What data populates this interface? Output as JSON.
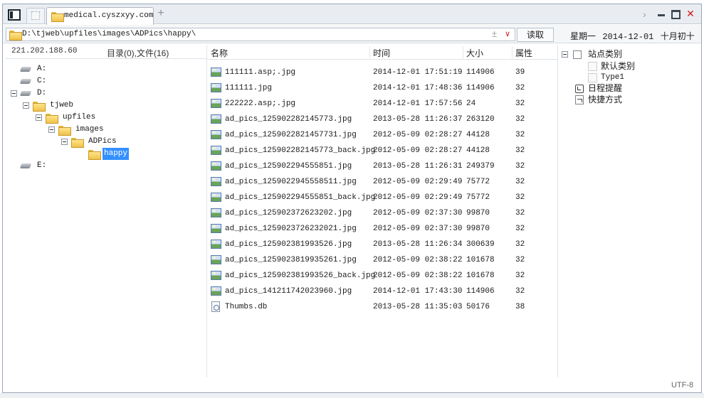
{
  "tabs": [
    {
      "label": "medical.cyszxyy.com"
    }
  ],
  "address": {
    "path": "D:\\tjweb\\upfiles\\images\\ADPics\\happy\\",
    "plus": "±",
    "dropdown": "∨",
    "read_label": "读取"
  },
  "header_date": {
    "weekday": "星期一",
    "date": "2014-12-01",
    "lunar": "十月初十"
  },
  "left": {
    "host": "221.202.188.60",
    "summary": "目录(0),文件(16)",
    "tree": [
      {
        "label": "A:"
      },
      {
        "label": "C:"
      },
      {
        "label": "D:"
      },
      {
        "label": "tjweb"
      },
      {
        "label": "upfiles"
      },
      {
        "label": "images"
      },
      {
        "label": "ADPics"
      },
      {
        "label": "happy"
      },
      {
        "label": "E:"
      }
    ]
  },
  "list": {
    "columns": {
      "name": "名称",
      "time": "时间",
      "size": "大小",
      "attr": "属性"
    },
    "rows": [
      {
        "name": "111111.asp;.jpg",
        "time": "2014-12-01 17:51:19",
        "size": "114906",
        "attr": "39"
      },
      {
        "name": "111111.jpg",
        "time": "2014-12-01 17:48:36",
        "size": "114906",
        "attr": "32"
      },
      {
        "name": "222222.asp;.jpg",
        "time": "2014-12-01 17:57:56",
        "size": "24",
        "attr": "32"
      },
      {
        "name": "ad_pics_125902282145773.jpg",
        "time": "2013-05-28 11:26:37",
        "size": "263120",
        "attr": "32"
      },
      {
        "name": "ad_pics_1259022821457731.jpg",
        "time": "2012-05-09 02:28:27",
        "size": "44128",
        "attr": "32"
      },
      {
        "name": "ad_pics_125902282145773_back.jpg",
        "time": "2012-05-09 02:28:27",
        "size": "44128",
        "attr": "32"
      },
      {
        "name": "ad_pics_125902294555851.jpg",
        "time": "2013-05-28 11:26:31",
        "size": "249379",
        "attr": "32"
      },
      {
        "name": "ad_pics_1259022945558511.jpg",
        "time": "2012-05-09 02:29:49",
        "size": "75772",
        "attr": "32"
      },
      {
        "name": "ad_pics_125902294555851_back.jpg",
        "time": "2012-05-09 02:29:49",
        "size": "75772",
        "attr": "32"
      },
      {
        "name": "ad_pics_125902372623202.jpg",
        "time": "2012-05-09 02:37:30",
        "size": "99870",
        "attr": "32"
      },
      {
        "name": "ad_pics_1259023726232021.jpg",
        "time": "2012-05-09 02:37:30",
        "size": "99870",
        "attr": "32"
      },
      {
        "name": "ad_pics_125902381993526.jpg",
        "time": "2013-05-28 11:26:34",
        "size": "300639",
        "attr": "32"
      },
      {
        "name": "ad_pics_1259023819935261.jpg",
        "time": "2012-05-09 02:38:22",
        "size": "101678",
        "attr": "32"
      },
      {
        "name": "ad_pics_125902381993526_back.jpg",
        "time": "2012-05-09 02:38:22",
        "size": "101678",
        "attr": "32"
      },
      {
        "name": "ad_pics_141211742023960.jpg",
        "time": "2014-12-01 17:43:30",
        "size": "114906",
        "attr": "32"
      },
      {
        "name": "Thumbs.db",
        "time": "2013-05-28 11:35:03",
        "size": "50176",
        "attr": "38"
      }
    ]
  },
  "right": {
    "items": [
      {
        "label": "站点类别"
      },
      {
        "label": "默认类别"
      },
      {
        "label": "Type1"
      },
      {
        "label": "日程提醒"
      },
      {
        "label": "快捷方式"
      }
    ]
  },
  "status": {
    "encoding": "UTF-8"
  },
  "icons": {
    "sidebar_toggle": "sidebar-toggle-icon",
    "folder": "folder-icon",
    "drive": "drive-icon",
    "image_file": "image-file-icon",
    "db_file": "document-icon",
    "close": "close-icon"
  },
  "colors": {
    "selection": "#3390ff",
    "close": "#d4161a"
  }
}
